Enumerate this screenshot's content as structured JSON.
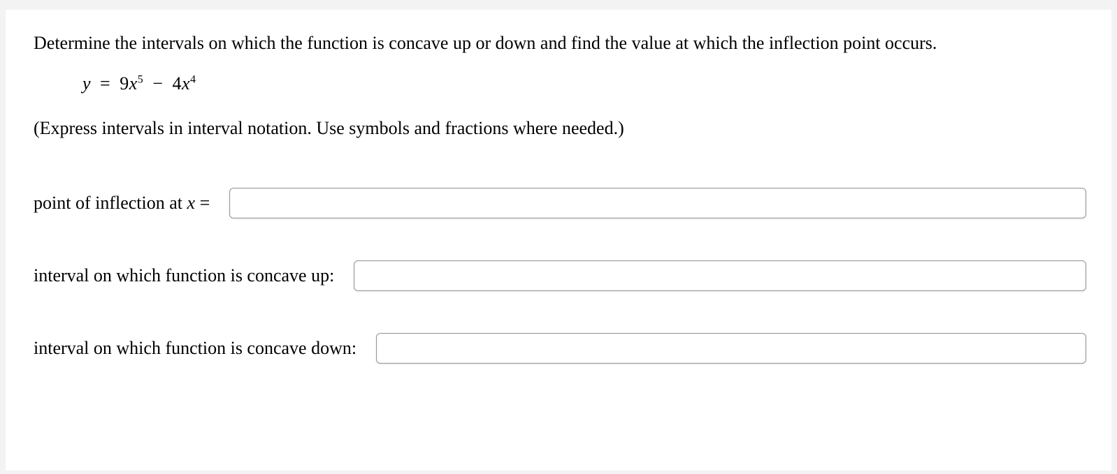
{
  "question": {
    "prompt": "Determine the intervals on which the function is concave up or down and find the value at which the inflection point occurs.",
    "equation": {
      "lhs_var": "y",
      "equals": "=",
      "term1_coef": "9",
      "term1_var": "x",
      "term1_exp": "5",
      "minus": "−",
      "term2_coef": "4",
      "term2_var": "x",
      "term2_exp": "4"
    },
    "hint": "(Express intervals in interval notation. Use symbols and fractions where needed.)"
  },
  "answers": {
    "inflection": {
      "label_prefix": "point of inflection at ",
      "label_var": "x",
      "label_equals": " =",
      "value": ""
    },
    "concave_up": {
      "label": "interval on which function is concave up:",
      "value": ""
    },
    "concave_down": {
      "label": "interval on which function is concave down:",
      "value": ""
    }
  }
}
